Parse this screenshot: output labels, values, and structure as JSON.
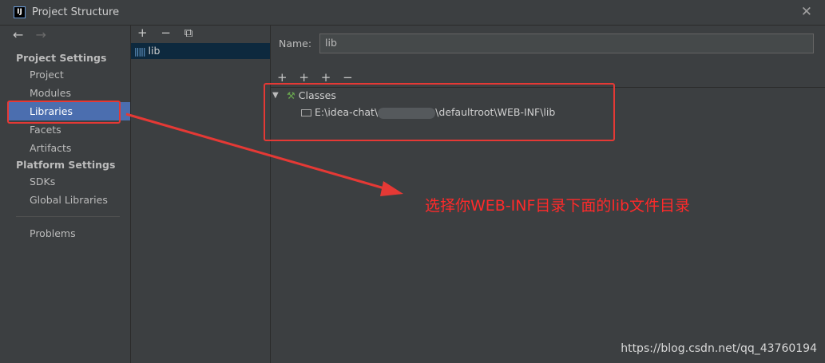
{
  "window": {
    "title": "Project Structure",
    "app_icon": "IJ",
    "close_glyph": "✕"
  },
  "nav": {
    "back": "←",
    "forward": "→"
  },
  "sidebar": {
    "project_settings_header": "Project Settings",
    "platform_settings_header": "Platform Settings",
    "items": [
      {
        "label": "Project"
      },
      {
        "label": "Modules"
      },
      {
        "label": "Libraries"
      },
      {
        "label": "Facets"
      },
      {
        "label": "Artifacts"
      },
      {
        "label": "SDKs"
      },
      {
        "label": "Global Libraries"
      },
      {
        "label": "Problems"
      }
    ]
  },
  "middle": {
    "toolbar": {
      "add": "+",
      "remove": "−",
      "copy": "⧉"
    },
    "libraries": [
      {
        "label": "lib"
      }
    ]
  },
  "detail": {
    "name_label": "Name:",
    "name_value": "lib",
    "toolbar": {
      "add": "+",
      "add_special": "+",
      "add_alt": "+",
      "remove": "−"
    },
    "tree": {
      "expand_glyph": "▼",
      "classes_label": "Classes",
      "path_prefix": "E:\\idea-chat\\",
      "path_suffix": "\\defaultroot\\WEB-INF\\lib"
    }
  },
  "annotation": {
    "text": "选择你WEB-INF目录下面的lib文件目录",
    "color": "#ff2a2a"
  },
  "watermark": "https://blog.csdn.net/qq_43760194",
  "colors": {
    "selection": "#4b6eaf",
    "background": "#3c3f41",
    "red": "#e53935"
  },
  "icons": [
    "app-icon",
    "close-icon",
    "back-arrow-icon",
    "forward-arrow-icon",
    "add-icon",
    "remove-icon",
    "copy-icon",
    "library-icon",
    "hammer-icon",
    "folder-icon",
    "expand-arrow-icon"
  ]
}
